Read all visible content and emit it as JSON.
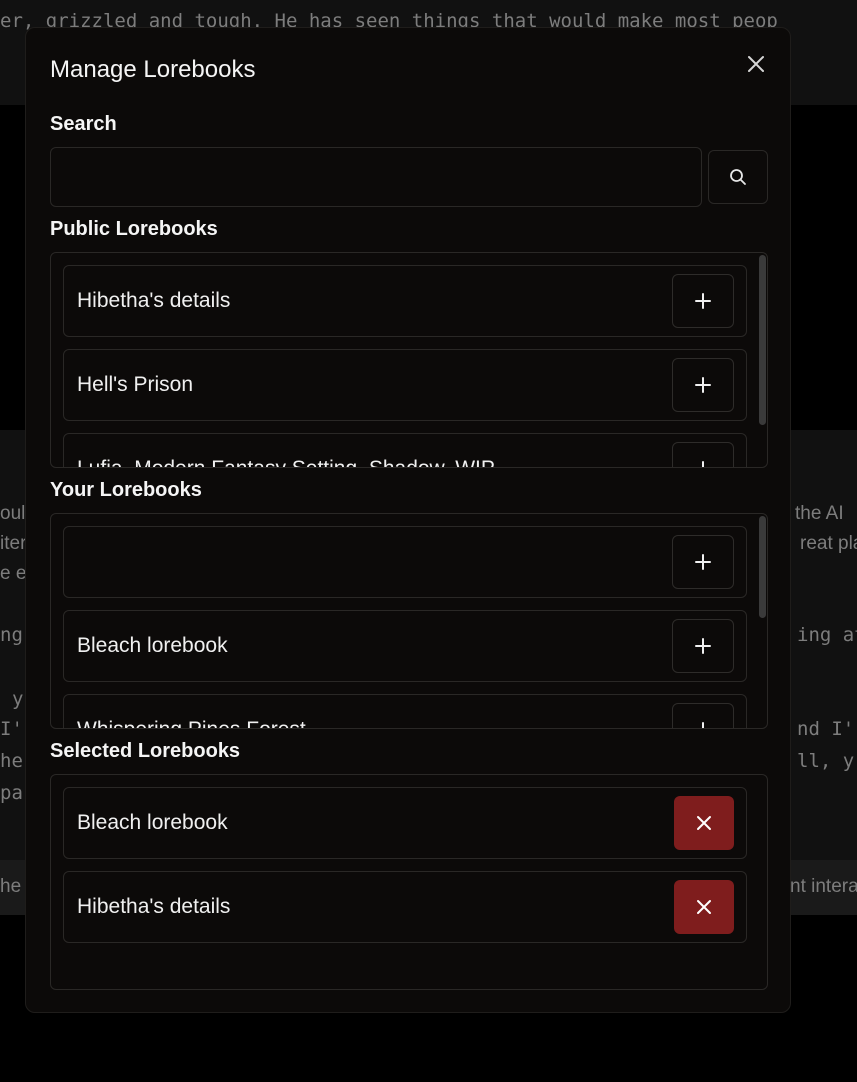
{
  "background": {
    "lines": [
      "er, grizzled and tough. He has seen things that would make most peop",
      "oul",
      "the AI",
      "iter",
      "reat pla",
      "e e",
      "ng",
      "ing at",
      "y",
      "I'",
      "nd I'",
      "he",
      "ll, y",
      "pa",
      "he",
      "nt intera"
    ]
  },
  "modal": {
    "title": "Manage Lorebooks",
    "close_icon": "x-icon",
    "search": {
      "label": "Search",
      "value": "",
      "placeholder": "",
      "button_icon": "search-icon"
    },
    "public": {
      "label": "Public Lorebooks",
      "items": [
        {
          "label": "Hibetha's details"
        },
        {
          "label": "Hell's Prison"
        },
        {
          "label": "Lufia, Modern Fantasy Setting, Shadow, WIP"
        }
      ]
    },
    "yours": {
      "label": "Your Lorebooks",
      "items": [
        {
          "label": ""
        },
        {
          "label": "Bleach lorebook"
        },
        {
          "label": "Whispering Pines Forest"
        }
      ]
    },
    "selected": {
      "label": "Selected Lorebooks",
      "items": [
        {
          "label": "Bleach lorebook"
        },
        {
          "label": "Hibetha's details"
        }
      ]
    }
  },
  "colors": {
    "modal_bg": "#0c0a09",
    "border": "#2a2826",
    "remove_button": "#7f1d1d",
    "text": "#f5f5f5"
  }
}
